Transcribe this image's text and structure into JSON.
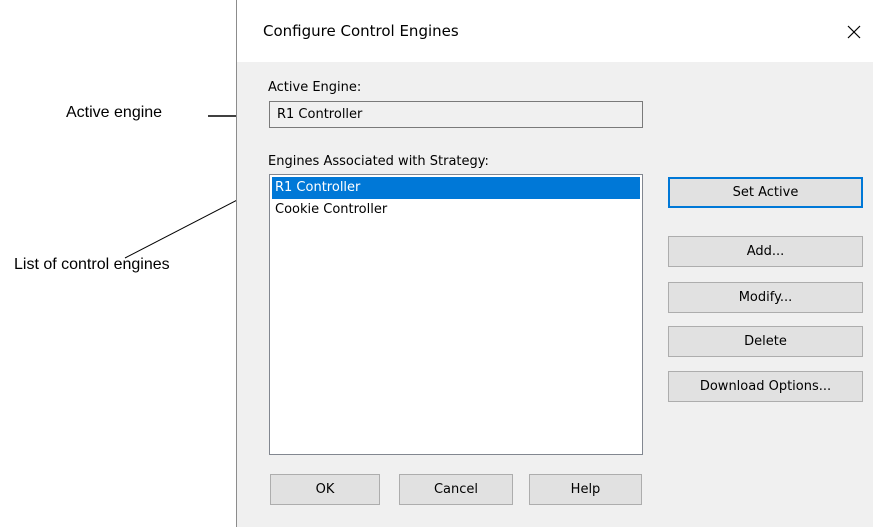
{
  "callouts": {
    "active_engine": "Active engine",
    "list_engines": "List of control engines"
  },
  "dialog": {
    "title": "Configure Control Engines",
    "close_icon": "close-icon",
    "active_engine_label": "Active Engine:",
    "active_engine_value": "R1 Controller",
    "engines_label": "Engines Associated with Strategy:",
    "engines": [
      {
        "name": "R1 Controller",
        "selected": true
      },
      {
        "name": "Cookie Controller",
        "selected": false
      }
    ],
    "buttons": {
      "set_active": "Set Active",
      "add": "Add...",
      "modify": "Modify...",
      "delete": "Delete",
      "download_options": "Download Options...",
      "ok": "OK",
      "cancel": "Cancel",
      "help": "Help"
    }
  },
  "colors": {
    "selection": "#0078d7",
    "dialog_bg": "#f0f0f0",
    "button_bg": "#e1e1e1"
  }
}
